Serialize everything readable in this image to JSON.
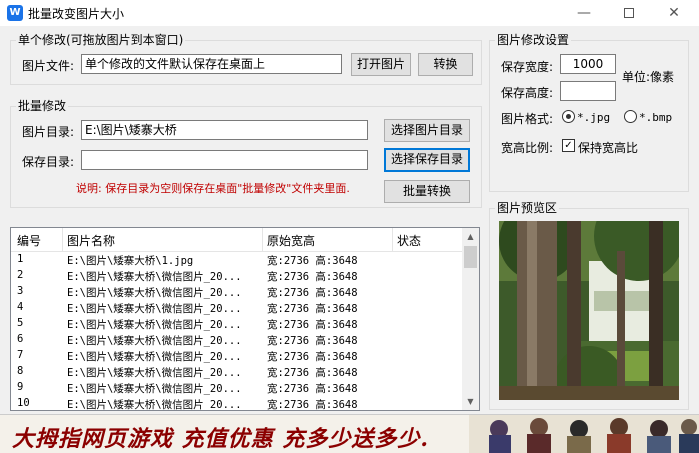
{
  "window": {
    "title": "批量改变图片大小",
    "icon": "app-icon",
    "min": "—",
    "close": "✕"
  },
  "single": {
    "group_title": "单个修改(可拖放图片到本窗口)",
    "file_label": "图片文件:",
    "file_value": "单个修改的文件默认保存在桌面上",
    "open_button": "打开图片",
    "convert_button": "转换"
  },
  "batch": {
    "group_title": "批量修改",
    "dir_label": "图片目录:",
    "dir_value": "E:\\图片\\矮寨大桥",
    "select_dir_button": "选择图片目录",
    "save_label": "保存目录:",
    "save_value": "",
    "select_save_button": "选择保存目录",
    "note": "说明: 保存目录为空则保存在桌面\"批量修改\"文件夹里面.",
    "batch_button": "批量转换"
  },
  "settings": {
    "group_title": "图片修改设置",
    "width_label": "保存宽度:",
    "width_value": "1000",
    "unit_label": "单位:像素",
    "height_label": "保存高度:",
    "height_value": "",
    "format_label": "图片格式:",
    "format_jpg": "*.jpg",
    "format_bmp": "*.bmp",
    "selected_format": "jpg",
    "ratio_label": "宽高比例:",
    "keep_ratio_label": "保持宽高比",
    "keep_ratio_checked": true,
    "check_mark": "✓"
  },
  "preview": {
    "group_title": "图片预览区"
  },
  "table": {
    "columns": [
      "编号",
      "图片名称",
      "原始宽高",
      "状态"
    ],
    "rows": [
      {
        "num": "1",
        "name": "E:\\图片\\矮寨大桥\\1.jpg",
        "size": "宽:2736 高:3648",
        "status": ""
      },
      {
        "num": "2",
        "name": "E:\\图片\\矮寨大桥\\微信图片_20...",
        "size": "宽:2736 高:3648",
        "status": ""
      },
      {
        "num": "3",
        "name": "E:\\图片\\矮寨大桥\\微信图片_20...",
        "size": "宽:2736 高:3648",
        "status": ""
      },
      {
        "num": "4",
        "name": "E:\\图片\\矮寨大桥\\微信图片_20...",
        "size": "宽:2736 高:3648",
        "status": ""
      },
      {
        "num": "5",
        "name": "E:\\图片\\矮寨大桥\\微信图片_20...",
        "size": "宽:2736 高:3648",
        "status": ""
      },
      {
        "num": "6",
        "name": "E:\\图片\\矮寨大桥\\微信图片_20...",
        "size": "宽:2736 高:3648",
        "status": ""
      },
      {
        "num": "7",
        "name": "E:\\图片\\矮寨大桥\\微信图片_20...",
        "size": "宽:2736 高:3648",
        "status": ""
      },
      {
        "num": "8",
        "name": "E:\\图片\\矮寨大桥\\微信图片_20...",
        "size": "宽:2736 高:3648",
        "status": ""
      },
      {
        "num": "9",
        "name": "E:\\图片\\矮寨大桥\\微信图片_20...",
        "size": "宽:2736 高:3648",
        "status": ""
      },
      {
        "num": "10",
        "name": "E:\\图片\\矮寨大桥\\微信图片_20...",
        "size": "宽:2736 高:3648",
        "status": ""
      }
    ]
  },
  "banner": {
    "text": "大拇指网页游戏 充值优惠 充多少送多少."
  }
}
